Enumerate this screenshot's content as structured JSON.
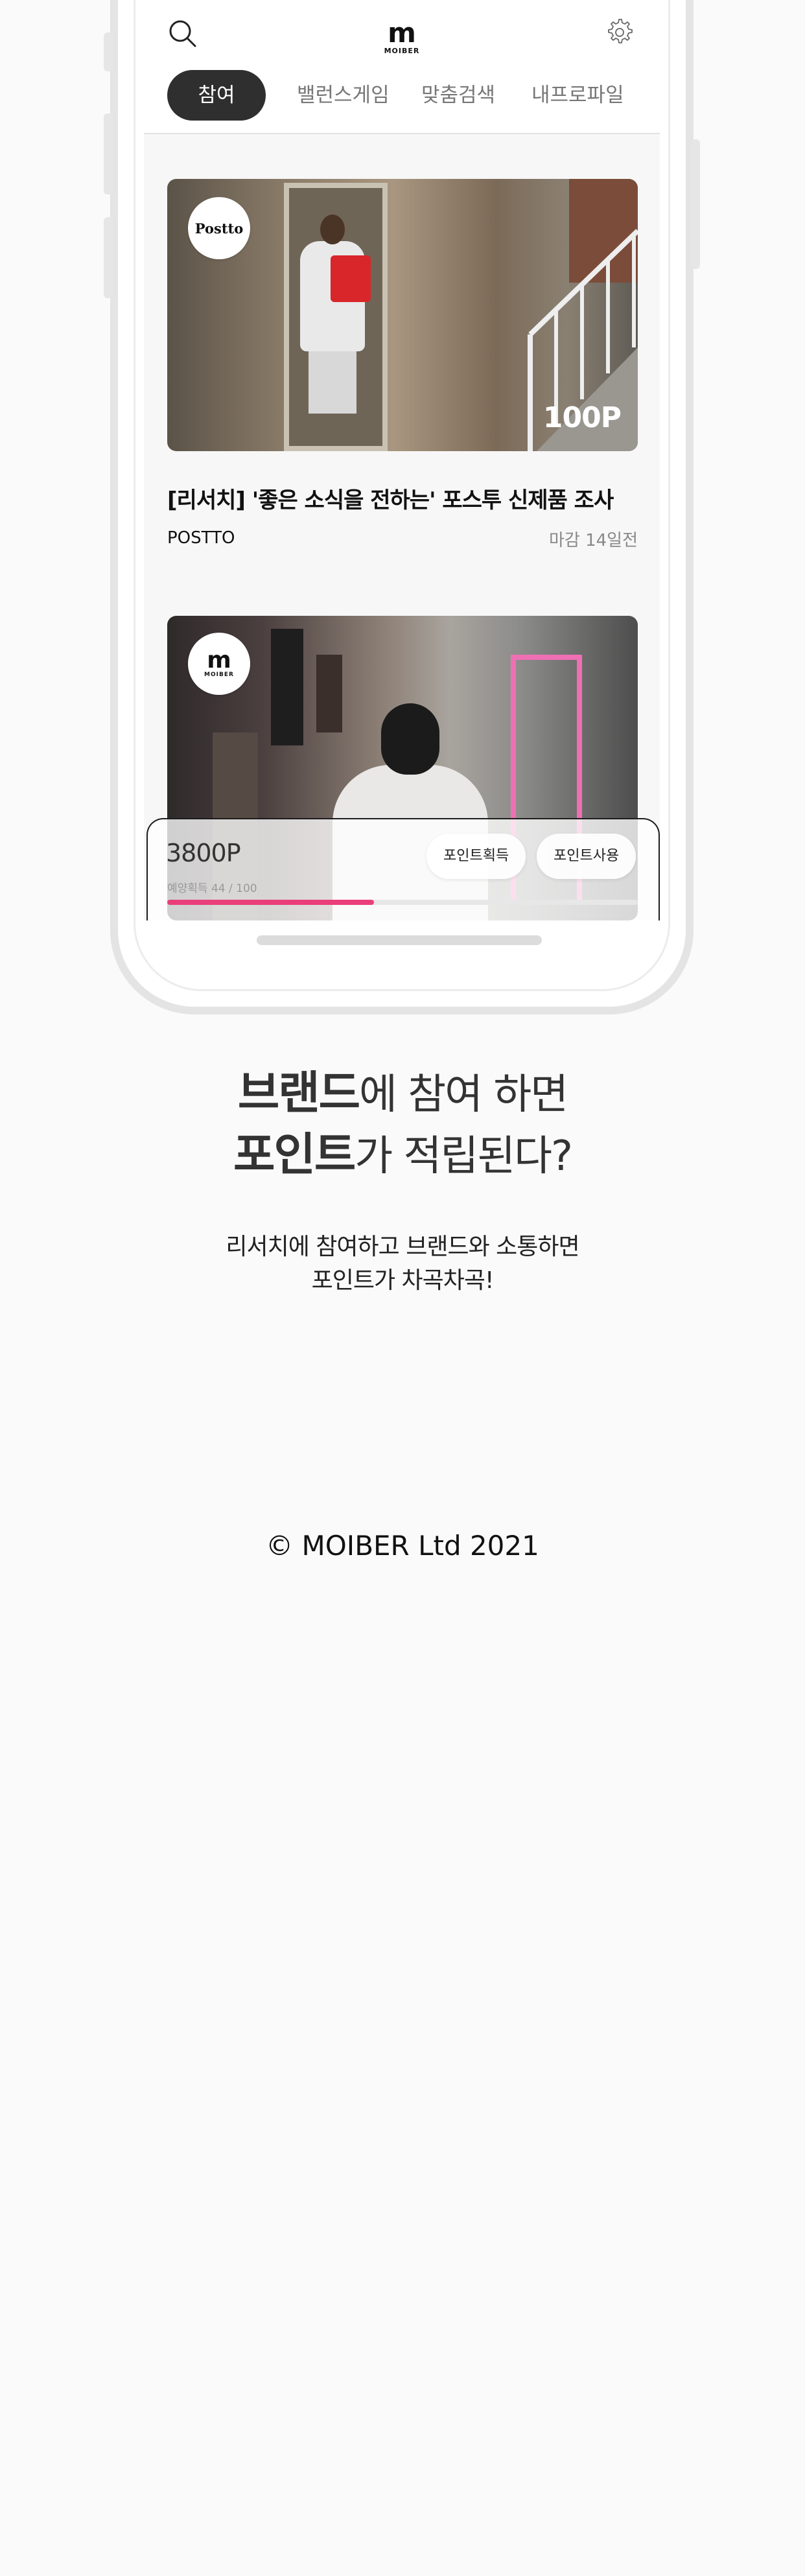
{
  "app": {
    "logo_text": "MOIBER",
    "tabs": [
      "참여",
      "밸런스게임",
      "맞춤검색",
      "내프로파일"
    ]
  },
  "cards": [
    {
      "brand_badge": "Postto",
      "points": "100P",
      "title": "[리서치] '좋은 소식을 전하는' 포스투 신제품 조사",
      "brand": "POSTTO",
      "deadline": "마감 14일전"
    },
    {
      "brand_badge": "MOIBER"
    }
  ],
  "bottom_panel": {
    "points": "3800P",
    "exp_label": "예양획득 44 / 100",
    "exp_progress": 0.44,
    "earn_button": "포인트획득",
    "use_button": "포인트사용"
  },
  "promo": {
    "headline_line1_bold": "브랜드",
    "headline_line1_rest": "에 참여 하면",
    "headline_line2_bold": "포인트",
    "headline_line2_rest": "가 적립된다?",
    "sub_line1": "리서치에 참여하고 브랜드와 소통하면",
    "sub_line2": "포인트가 차곡차곡!"
  },
  "footer": {
    "copyright": "© MOIBER Ltd 2021"
  },
  "colors": {
    "accent": "#ea3e7b",
    "tab_active_bg": "#2f2f2f"
  }
}
